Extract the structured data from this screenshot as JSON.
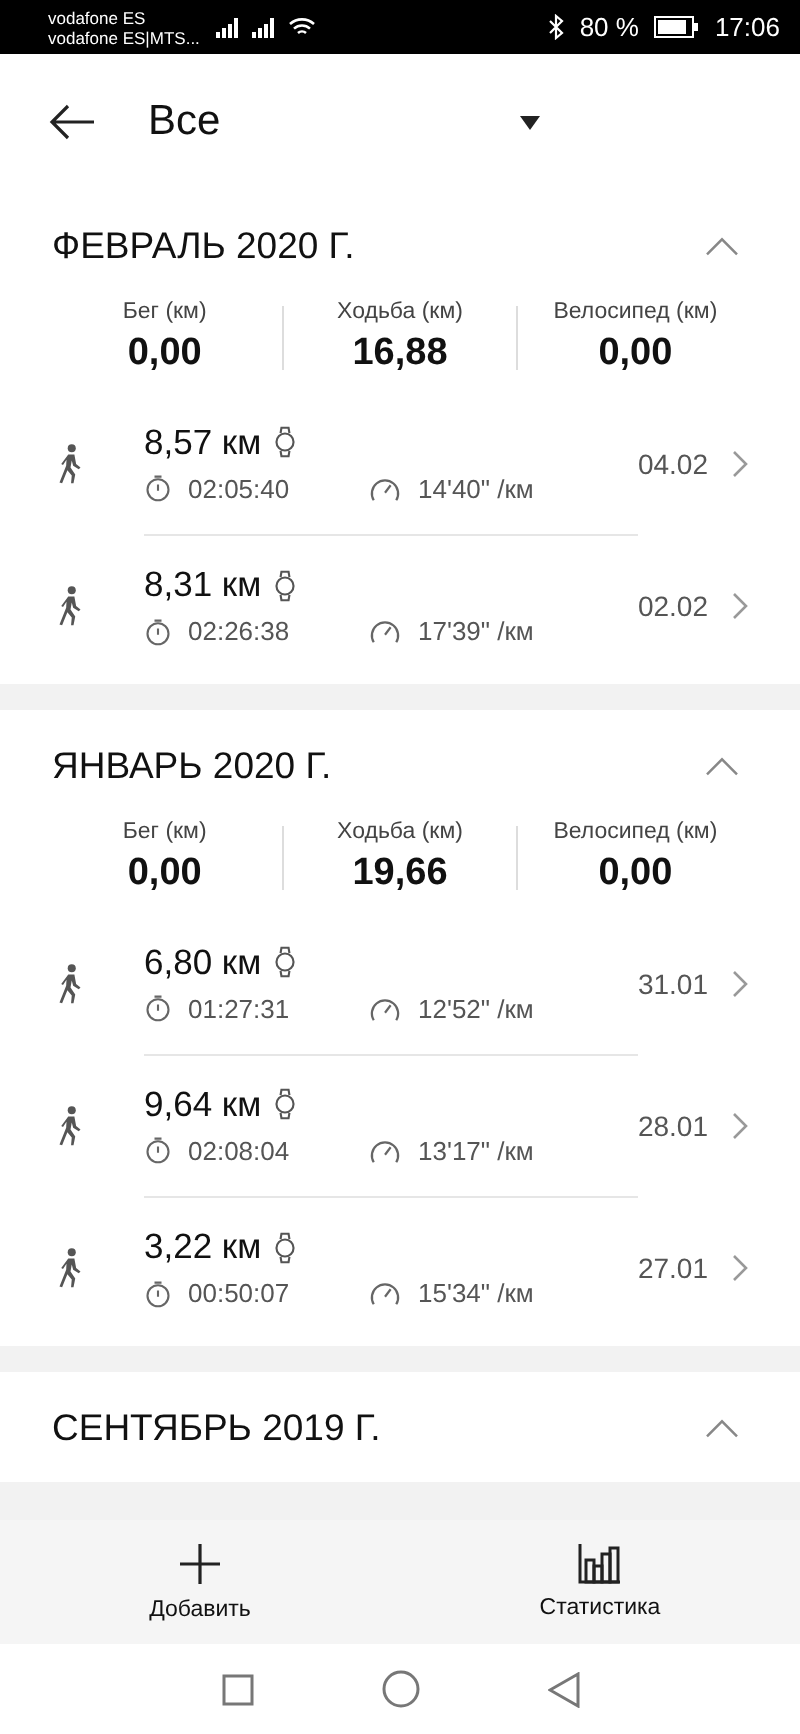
{
  "status_bar": {
    "carrier_1": "vodafone ES",
    "carrier_2": "vodafone ES|MTS...",
    "battery": "80 %",
    "time": "17:06"
  },
  "header": {
    "filter": "Все"
  },
  "sections": [
    {
      "title": "ФЕВРАЛЬ 2020 Г.",
      "expanded": true,
      "stats": [
        {
          "label": "Бег (км)",
          "value": "0,00"
        },
        {
          "label": "Ходьба (км)",
          "value": "16,88"
        },
        {
          "label": "Велосипед (км)",
          "value": "0,00"
        }
      ],
      "records": [
        {
          "distance": "8,57 км",
          "duration": "02:05:40",
          "pace": "14'40\" /км",
          "date": "04.02"
        },
        {
          "distance": "8,31 км",
          "duration": "02:26:38",
          "pace": "17'39\" /км",
          "date": "02.02"
        }
      ]
    },
    {
      "title": "ЯНВАРЬ 2020 Г.",
      "expanded": true,
      "stats": [
        {
          "label": "Бег (км)",
          "value": "0,00"
        },
        {
          "label": "Ходьба (км)",
          "value": "19,66"
        },
        {
          "label": "Велосипед (км)",
          "value": "0,00"
        }
      ],
      "records": [
        {
          "distance": "6,80 км",
          "duration": "01:27:31",
          "pace": "12'52\" /км",
          "date": "31.01"
        },
        {
          "distance": "9,64 км",
          "duration": "02:08:04",
          "pace": "13'17\" /км",
          "date": "28.01"
        },
        {
          "distance": "3,22 км",
          "duration": "00:50:07",
          "pace": "15'34\" /км",
          "date": "27.01"
        }
      ]
    },
    {
      "title": "СЕНТЯБРЬ 2019 Г.",
      "expanded": true
    }
  ],
  "bottom_actions": [
    {
      "kind": "add",
      "label": "Добавить"
    },
    {
      "kind": "stats",
      "label": "Статистика"
    }
  ]
}
